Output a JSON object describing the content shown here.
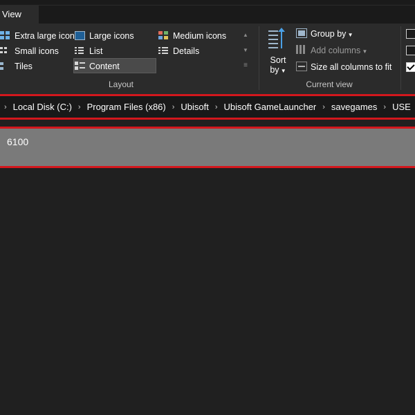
{
  "tabs": {
    "view_label": "View"
  },
  "layout": {
    "items": [
      {
        "label": "Extra large icons",
        "icon": "extra-large-icons-icon"
      },
      {
        "label": "Large icons",
        "icon": "large-icons-icon"
      },
      {
        "label": "Medium icons",
        "icon": "medium-icons-icon"
      },
      {
        "label": "Small icons",
        "icon": "small-icons-icon"
      },
      {
        "label": "List",
        "icon": "list-icon"
      },
      {
        "label": "Details",
        "icon": "details-icon"
      },
      {
        "label": "Tiles",
        "icon": "tiles-icon"
      },
      {
        "label": "Content",
        "icon": "content-icon",
        "selected": true
      }
    ],
    "group_label": "Layout"
  },
  "current_view": {
    "sort_label_1": "Sort",
    "sort_label_2": "by",
    "group_by": "Group by",
    "add_columns": "Add columns",
    "size_all_columns": "Size all columns to fit",
    "group_label": "Current view"
  },
  "show_hide": {
    "checkboxes": [
      false,
      false,
      true
    ]
  },
  "address_bar": {
    "crumbs": [
      "Local Disk (C:)",
      "Program Files (x86)",
      "Ubisoft",
      "Ubisoft GameLauncher",
      "savegames",
      "USE"
    ]
  },
  "file_list": {
    "items": [
      {
        "name": "6100"
      }
    ]
  },
  "colors": {
    "highlight_border": "#d3171d",
    "selected_row": "#7a7a7a",
    "background": "#202020"
  }
}
